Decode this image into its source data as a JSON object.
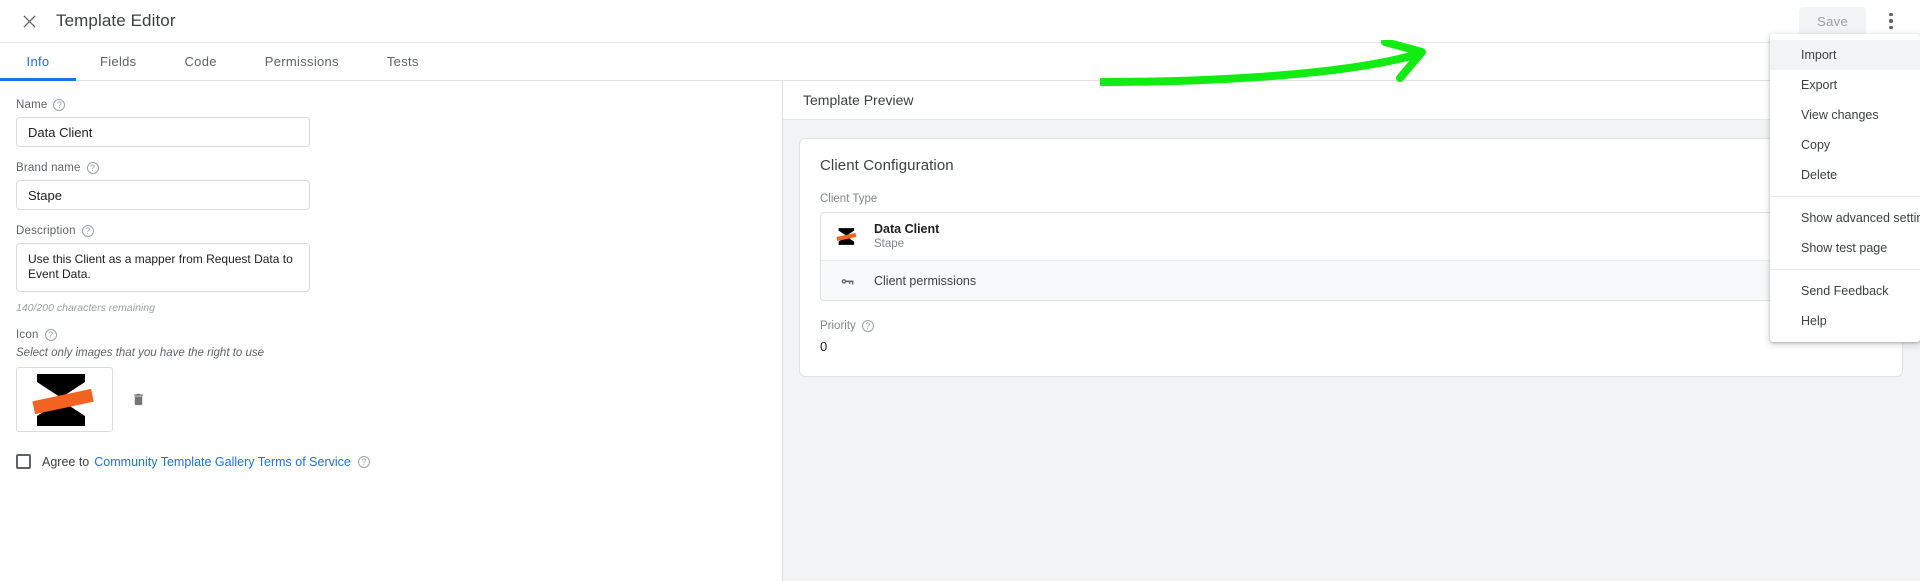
{
  "header": {
    "close_icon": "close-icon",
    "title": "Template Editor",
    "save_label": "Save",
    "kebab_icon": "more-vert-icon"
  },
  "tabs": [
    {
      "label": "Info",
      "active": true
    },
    {
      "label": "Fields",
      "active": false
    },
    {
      "label": "Code",
      "active": false
    },
    {
      "label": "Permissions",
      "active": false
    },
    {
      "label": "Tests",
      "active": false
    }
  ],
  "form": {
    "name": {
      "label": "Name",
      "value": "Data Client",
      "help_icon": "help-circle-icon"
    },
    "brand_name": {
      "label": "Brand name",
      "value": "Stape",
      "help_icon": "help-circle-icon"
    },
    "description": {
      "label": "Description",
      "value": "Use this Client as a mapper from Request Data to Event Data.",
      "help_icon": "help-circle-icon",
      "counter": "140/200 characters remaining"
    },
    "icon": {
      "label": "Icon",
      "help_icon": "help-circle-icon",
      "hint": "Select only images that you have the right to use",
      "thumbnail_alt": "stape-logo",
      "delete_icon": "trash-icon"
    },
    "terms": {
      "checked": false,
      "prefix": "Agree to",
      "link": "Community Template Gallery Terms of Service",
      "help_icon": "help-circle-icon"
    }
  },
  "preview": {
    "title": "Template Preview",
    "card_title": "Client Configuration",
    "client_type_label": "Client Type",
    "options": [
      {
        "icon": "stape-logo-icon",
        "title": "Data Client",
        "subtitle": "Stape",
        "selected": true
      },
      {
        "icon": "key-icon",
        "title": "Client permissions",
        "subtitle": "",
        "selected": false
      }
    ],
    "priority": {
      "label": "Priority",
      "help_icon": "help-circle-icon",
      "value": "0"
    }
  },
  "menu": {
    "items": [
      {
        "label": "Import",
        "hover": true
      },
      {
        "label": "Export",
        "hover": false
      },
      {
        "label": "View changes",
        "hover": false
      },
      {
        "label": "Copy",
        "hover": false
      },
      {
        "label": "Delete",
        "hover": false
      },
      {
        "separator": true
      },
      {
        "label": "Show advanced settings",
        "hover": false
      },
      {
        "label": "Show test page",
        "hover": false
      },
      {
        "separator": true
      },
      {
        "label": "Send Feedback",
        "hover": false
      },
      {
        "label": "Help",
        "hover": false
      }
    ]
  },
  "annotation": {
    "type": "arrow",
    "color": "#13ec13",
    "points_to": "Import"
  },
  "colors": {
    "accent": "#1a73e8",
    "brand_orange": "#f26322",
    "brand_black": "#000000",
    "annotation_green": "#13ec13",
    "text_primary": "#202124",
    "text_secondary": "#5f6368"
  }
}
